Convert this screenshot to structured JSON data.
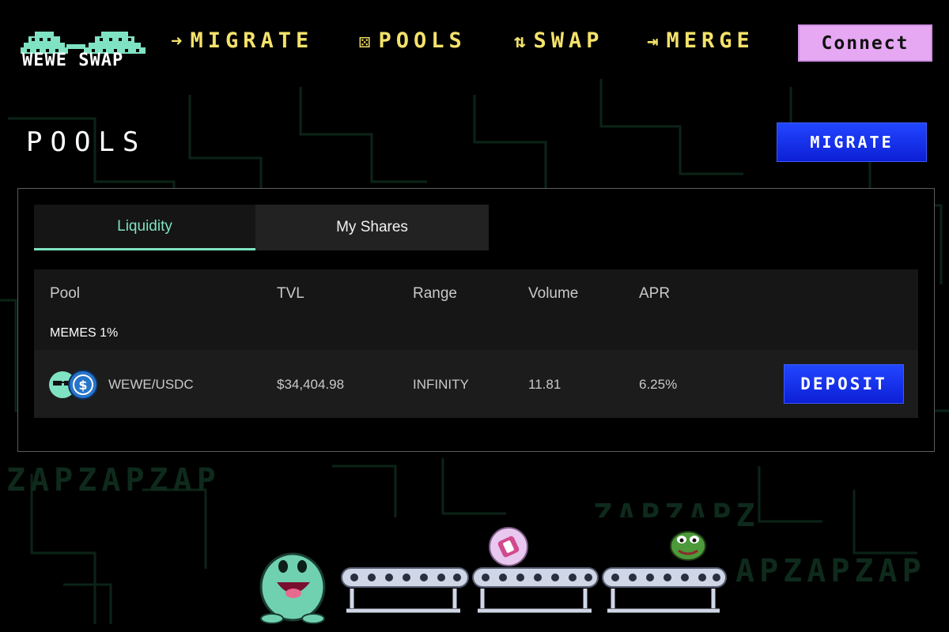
{
  "header": {
    "logo_text": "WEWE SWAP",
    "nav": [
      {
        "label": "MIGRATE",
        "icon": "arrow-right-icon"
      },
      {
        "label": "POOLS",
        "icon": "dice-icon"
      },
      {
        "label": "SWAP",
        "icon": "swap-icon"
      },
      {
        "label": "MERGE",
        "icon": "merge-icon"
      }
    ],
    "connect_label": "Connect"
  },
  "page": {
    "title": "POOLS",
    "migrate_label": "MIGRATE"
  },
  "tabs": [
    {
      "label": "Liquidity",
      "active": true
    },
    {
      "label": "My Shares",
      "active": false
    }
  ],
  "table": {
    "columns": [
      "Pool",
      "TVL",
      "Range",
      "Volume",
      "APR"
    ],
    "group_label": "MEMES 1%",
    "rows": [
      {
        "pool": "WEWE/USDC",
        "tvl": "$34,404.98",
        "range": "INFINITY",
        "volume": "11.81",
        "apr": "6.25%",
        "action": "DEPOSIT"
      }
    ]
  },
  "background": {
    "watermark_top": "ZAPZAPZAP",
    "watermark_right": "ZAPZAPZ",
    "watermark_right2": "APZAPZAP"
  },
  "colors": {
    "accent_green": "#7fe3c3",
    "nav_yellow": "#f4e26a",
    "connect_pink": "#e6a8f2",
    "button_blue": "#1530ea"
  }
}
